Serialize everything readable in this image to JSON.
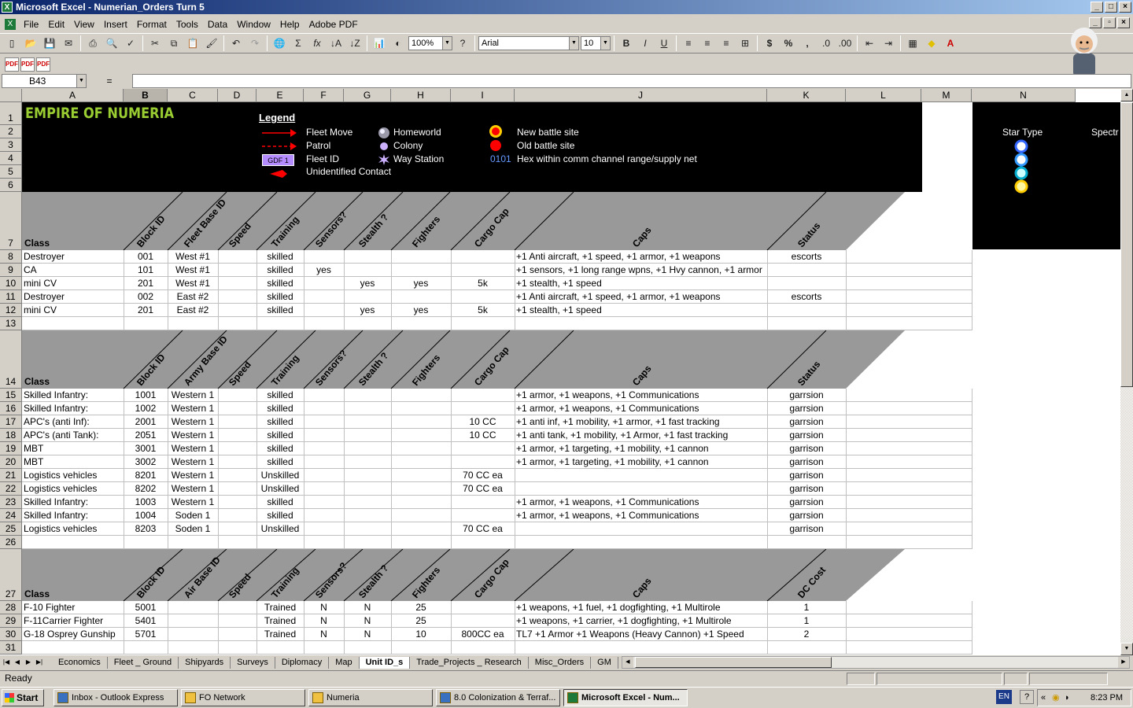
{
  "window": {
    "title": "Microsoft Excel - Numerian_Orders Turn 5"
  },
  "menu": [
    "File",
    "Edit",
    "View",
    "Insert",
    "Format",
    "Tools",
    "Data",
    "Window",
    "Help",
    "Adobe PDF"
  ],
  "toolbar": {
    "zoom": "100%",
    "font": "Arial",
    "size": "10",
    "bold": "B",
    "italic": "I",
    "underline": "U",
    "sigma": "Σ",
    "fx": "fx",
    "currency": "$",
    "percent": "%",
    "comma": ","
  },
  "formula": {
    "name_box": "B43",
    "eq": "="
  },
  "columns": [
    "A",
    "B",
    "C",
    "D",
    "E",
    "F",
    "G",
    "H",
    "I",
    "J",
    "K",
    "L",
    "M",
    "N"
  ],
  "legend": {
    "title": "EMPIRE OF NUMERIA",
    "heading": "Legend",
    "fleet_move": "Fleet Move",
    "patrol": "Patrol",
    "fleet_id": "Fleet ID",
    "gdf": "GDF  1",
    "unidentified": "Unidentified Contact",
    "homeworld": "Homeworld",
    "colony": "Colony",
    "way_station": "Way Station",
    "new_battle": "New battle site",
    "old_battle": "Old battle site",
    "hex_code": "0101",
    "hex_desc": "Hex within comm channel range/supply net",
    "star_type": "Star Type",
    "spectr": "Spectr"
  },
  "headers": {
    "fleet": [
      "Block ID",
      "Fleet Base ID",
      "Speed",
      "Training",
      "Sensors?",
      "Stealth ?",
      "Fighters",
      "Cargo Cap",
      "Caps",
      "Status"
    ],
    "army": [
      "Block ID",
      "Army Base ID",
      "Speed",
      "Training",
      "Sensors?",
      "Stealth ?",
      "Fighters",
      "Cargo Cap",
      "Caps",
      "Status"
    ],
    "air": [
      "Block ID",
      "Air Base ID",
      "Speed",
      "Training",
      "Sensors?",
      "Stealth ?",
      "Fighters",
      "Cargo Cap",
      "Caps",
      "DC Cost"
    ],
    "class": "Class"
  },
  "fleet_rows": [
    {
      "r": "8",
      "a": "Destroyer",
      "b": "001",
      "c": "West #1",
      "e": "skilled",
      "f": "",
      "g": "",
      "h": "",
      "i": "",
      "j": "+1 Anti aircraft, +1 speed, +1 armor, +1 weapons",
      "k": "escorts"
    },
    {
      "r": "9",
      "a": "CA",
      "b": "101",
      "c": "West #1",
      "e": "skilled",
      "f": "yes",
      "g": "",
      "h": "",
      "i": "",
      "j": "+1 sensors, +1 long range wpns, +1 Hvy cannon, +1 armor",
      "k": ""
    },
    {
      "r": "10",
      "a": "mini CV",
      "b": "201",
      "c": "West #1",
      "e": "skilled",
      "f": "",
      "g": "yes",
      "h": "yes",
      "i": "5k",
      "j": "+1 stealth, +1 speed",
      "k": ""
    },
    {
      "r": "11",
      "a": "Destroyer",
      "b": "002",
      "c": "East #2",
      "e": "skilled",
      "f": "",
      "g": "",
      "h": "",
      "i": "",
      "j": "+1 Anti aircraft, +1 speed, +1 armor, +1 weapons",
      "k": "escorts"
    },
    {
      "r": "12",
      "a": "mini CV",
      "b": "201",
      "c": "East #2",
      "e": "skilled",
      "f": "",
      "g": "yes",
      "h": "yes",
      "i": "5k",
      "j": "+1 stealth, +1 speed",
      "k": ""
    }
  ],
  "army_rows": [
    {
      "r": "15",
      "a": "Skilled Infantry:",
      "b": "1001",
      "c": "Western 1",
      "e": "skilled",
      "f": "",
      "g": "",
      "h": "",
      "i": "",
      "j": "+1 armor, +1 weapons, +1 Communications",
      "k": "garrsion"
    },
    {
      "r": "16",
      "a": "Skilled Infantry:",
      "b": "1002",
      "c": "Western 1",
      "e": "skilled",
      "f": "",
      "g": "",
      "h": "",
      "i": "",
      "j": "+1 armor, +1 weapons, +1 Communications",
      "k": "garrsion"
    },
    {
      "r": "17",
      "a": "APC's (anti Inf):",
      "b": "2001",
      "c": "Western 1",
      "e": "skilled",
      "f": "",
      "g": "",
      "h": "",
      "i": "10 CC",
      "j": "+1 anti inf, +1 mobility, +1 armor, +1 fast tracking",
      "k": "garrsion"
    },
    {
      "r": "18",
      "a": "APC's (anti Tank):",
      "b": "2051",
      "c": "Western 1",
      "e": "skilled",
      "f": "",
      "g": "",
      "h": "",
      "i": "10 CC",
      "j": "+1 anti tank, +1 mobility, +1 Armor, +1 fast tracking",
      "k": "garrsion"
    },
    {
      "r": "19",
      "a": "MBT",
      "b": "3001",
      "c": "Western 1",
      "e": "skilled",
      "f": "",
      "g": "",
      "h": "",
      "i": "",
      "j": "+1 armor, +1 targeting, +1 mobility, +1 cannon",
      "k": "garrison"
    },
    {
      "r": "20",
      "a": "MBT",
      "b": "3002",
      "c": "Western 1",
      "e": "skilled",
      "f": "",
      "g": "",
      "h": "",
      "i": "",
      "j": "+1 armor, +1 targeting, +1 mobility, +1 cannon",
      "k": "garrison"
    },
    {
      "r": "21",
      "a": "Logistics vehicles",
      "b": "8201",
      "c": "Western 1",
      "e": "Unskilled",
      "f": "",
      "g": "",
      "h": "",
      "i": "70 CC ea",
      "j": "",
      "k": "garrison"
    },
    {
      "r": "22",
      "a": "Logistics vehicles",
      "b": "8202",
      "c": "Western 1",
      "e": "Unskilled",
      "f": "",
      "g": "",
      "h": "",
      "i": "70 CC ea",
      "j": "",
      "k": "garrison"
    },
    {
      "r": "23",
      "a": "Skilled Infantry:",
      "b": "1003",
      "c": "Western 1",
      "e": "skilled",
      "f": "",
      "g": "",
      "h": "",
      "i": "",
      "j": "+1 armor, +1 weapons, +1 Communications",
      "k": "garrsion"
    },
    {
      "r": "24",
      "a": "Skilled Infantry:",
      "b": "1004",
      "c": "Soden 1",
      "e": "skilled",
      "f": "",
      "g": "",
      "h": "",
      "i": "",
      "j": "+1 armor, +1 weapons, +1 Communications",
      "k": "garrsion"
    },
    {
      "r": "25",
      "a": "Logistics vehicles",
      "b": "8203",
      "c": "Soden 1",
      "e": "Unskilled",
      "f": "",
      "g": "",
      "h": "",
      "i": "70 CC ea",
      "j": "",
      "k": "garrison"
    }
  ],
  "air_rows": [
    {
      "r": "28",
      "a": "F-10 Fighter",
      "b": "5001",
      "c": "",
      "e": "Trained",
      "f": "N",
      "g": "N",
      "h": "25",
      "i": "",
      "j": "+1 weapons, +1 fuel, +1 dogfighting, +1 Multirole",
      "k": "1"
    },
    {
      "r": "29",
      "a": "F-11Carrier Fighter",
      "b": "5401",
      "c": "",
      "e": "Trained",
      "f": "N",
      "g": "N",
      "h": "25",
      "i": "",
      "j": "+1 weapons, +1 carrier, +1 dogfighting, +1 Multirole",
      "k": "1"
    },
    {
      "r": "30",
      "a": "G-18 Osprey Gunship",
      "b": "5701",
      "c": "",
      "e": "Trained",
      "f": "N",
      "g": "N",
      "h": "10",
      "i": "800CC ea",
      "j": "TL7 +1 Armor +1 Weapons (Heavy Cannon) +1 Speed",
      "k": "2"
    }
  ],
  "tabs": [
    "Economics",
    "Fleet _ Ground",
    "Shipyards",
    "Surveys",
    "Diplomacy",
    "Map",
    "Unit ID_s",
    "Trade_Projects _ Research",
    "Misc_Orders",
    "GM"
  ],
  "active_tab": "Unit ID_s",
  "status": "Ready",
  "taskbar": {
    "start": "Start",
    "items": [
      "Inbox - Outlook Express",
      "FO Network",
      "Numeria",
      "8.0 Colonization & Terraf...",
      "Microsoft Excel - Num..."
    ],
    "lang": "EN",
    "help": "?",
    "time": "8:23 PM"
  }
}
